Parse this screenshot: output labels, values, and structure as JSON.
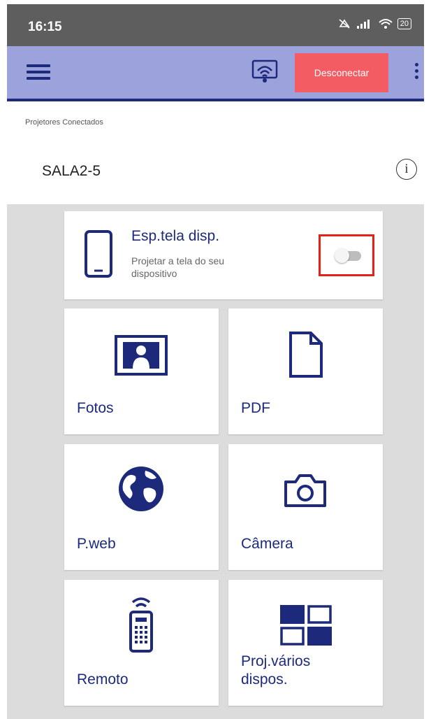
{
  "status_bar": {
    "time": "16:15",
    "battery": "20"
  },
  "app_bar": {
    "disconnect_label": "Desconectar"
  },
  "projectors": {
    "section_label": "Projetores Conectados",
    "name": "SALA2-5",
    "info_icon": "i"
  },
  "mirror": {
    "title": "Esp.tela disp.",
    "subtitle": "Projetar a tela do seu dispositivo",
    "toggle_on": false
  },
  "tiles": {
    "photos": "Fotos",
    "pdf": "PDF",
    "web": "P.web",
    "camera": "Câmera",
    "remote": "Remoto",
    "multi_line1": "Proj.vários",
    "multi_line2": "dispos."
  },
  "colors": {
    "accent": "#1d2a7c",
    "app_bar": "#9ca2db",
    "disconnect": "#f45c63",
    "highlight": "#e32119"
  }
}
